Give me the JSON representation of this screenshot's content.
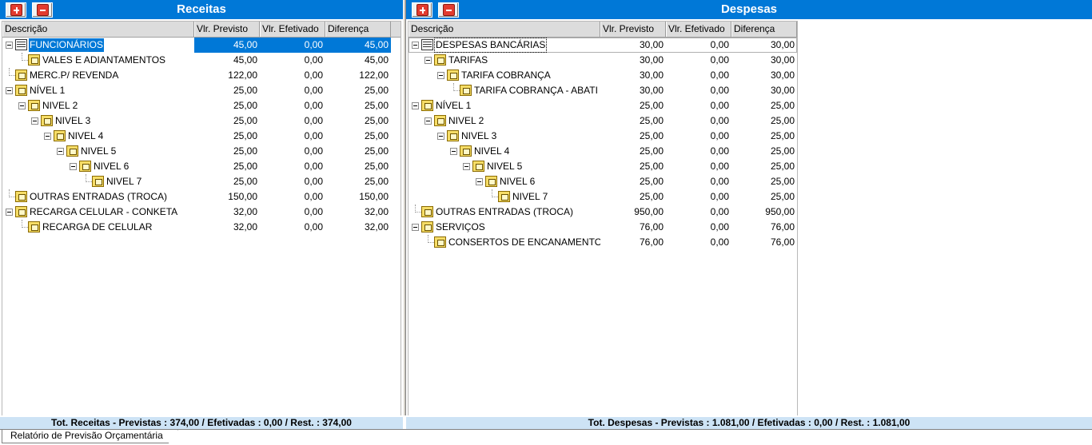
{
  "left": {
    "title": "Receitas",
    "columns": [
      "Descrição",
      "Vlr. Previsto",
      "Vlr. Efetivado",
      "Diferença"
    ],
    "rows": [
      {
        "level": 0,
        "icon": "table-icon",
        "toggle": true,
        "label": "FUNCIONÁRIOS",
        "prev": "45,00",
        "efet": "0,00",
        "dif": "45,00",
        "selected": true
      },
      {
        "level": 1,
        "icon": "folder-icon",
        "toggle": false,
        "label": "VALES E ADIANTAMENTOS",
        "prev": "45,00",
        "efet": "0,00",
        "dif": "45,00"
      },
      {
        "level": 0,
        "icon": "folder-icon",
        "toggle": false,
        "label": "MERC.P/ REVENDA",
        "prev": "122,00",
        "efet": "0,00",
        "dif": "122,00"
      },
      {
        "level": 0,
        "icon": "folder-icon",
        "toggle": true,
        "label": "NÍVEL 1",
        "prev": "25,00",
        "efet": "0,00",
        "dif": "25,00"
      },
      {
        "level": 1,
        "icon": "folder-icon",
        "toggle": true,
        "label": "NIVEL 2",
        "prev": "25,00",
        "efet": "0,00",
        "dif": "25,00"
      },
      {
        "level": 2,
        "icon": "folder-icon",
        "toggle": true,
        "label": "NIVEL 3",
        "prev": "25,00",
        "efet": "0,00",
        "dif": "25,00"
      },
      {
        "level": 3,
        "icon": "folder-icon",
        "toggle": true,
        "label": "NIVEL 4",
        "prev": "25,00",
        "efet": "0,00",
        "dif": "25,00"
      },
      {
        "level": 4,
        "icon": "folder-icon",
        "toggle": true,
        "label": "NIVEL 5",
        "prev": "25,00",
        "efet": "0,00",
        "dif": "25,00"
      },
      {
        "level": 5,
        "icon": "folder-icon",
        "toggle": true,
        "label": "NIVEL 6",
        "prev": "25,00",
        "efet": "0,00",
        "dif": "25,00"
      },
      {
        "level": 6,
        "icon": "folder-icon",
        "toggle": false,
        "label": "NIVEL 7",
        "prev": "25,00",
        "efet": "0,00",
        "dif": "25,00"
      },
      {
        "level": 0,
        "icon": "folder-icon",
        "toggle": false,
        "label": "OUTRAS ENTRADAS (TROCA)",
        "prev": "150,00",
        "efet": "0,00",
        "dif": "150,00"
      },
      {
        "level": 0,
        "icon": "folder-icon",
        "toggle": true,
        "label": "RECARGA CELULAR - CONKETA",
        "prev": "32,00",
        "efet": "0,00",
        "dif": "32,00"
      },
      {
        "level": 1,
        "icon": "folder-icon",
        "toggle": false,
        "label": "RECARGA DE CELULAR",
        "prev": "32,00",
        "efet": "0,00",
        "dif": "32,00"
      }
    ],
    "status": "Tot. Receitas - Previstas : 374,00 / Efetivadas : 0,00 / Rest. : 374,00"
  },
  "right": {
    "title": "Despesas",
    "columns": [
      "Descrição",
      "Vlr. Previsto",
      "Vlr. Efetivado",
      "Diferença"
    ],
    "rows": [
      {
        "level": 0,
        "icon": "table-icon",
        "toggle": true,
        "label": "DESPESAS BANCÁRIAS",
        "prev": "30,00",
        "efet": "0,00",
        "dif": "30,00",
        "focused": true
      },
      {
        "level": 1,
        "icon": "folder-icon",
        "toggle": true,
        "label": "TARIFAS",
        "prev": "30,00",
        "efet": "0,00",
        "dif": "30,00"
      },
      {
        "level": 2,
        "icon": "folder-icon",
        "toggle": true,
        "label": "TARIFA COBRANÇA",
        "prev": "30,00",
        "efet": "0,00",
        "dif": "30,00"
      },
      {
        "level": 3,
        "icon": "folder-icon",
        "toggle": false,
        "label": "TARIFA COBRANÇA - ABATI",
        "prev": "30,00",
        "efet": "0,00",
        "dif": "30,00"
      },
      {
        "level": 0,
        "icon": "folder-icon",
        "toggle": true,
        "label": "NÍVEL 1",
        "prev": "25,00",
        "efet": "0,00",
        "dif": "25,00"
      },
      {
        "level": 1,
        "icon": "folder-icon",
        "toggle": true,
        "label": "NIVEL 2",
        "prev": "25,00",
        "efet": "0,00",
        "dif": "25,00"
      },
      {
        "level": 2,
        "icon": "folder-icon",
        "toggle": true,
        "label": "NIVEL 3",
        "prev": "25,00",
        "efet": "0,00",
        "dif": "25,00"
      },
      {
        "level": 3,
        "icon": "folder-icon",
        "toggle": true,
        "label": "NIVEL 4",
        "prev": "25,00",
        "efet": "0,00",
        "dif": "25,00"
      },
      {
        "level": 4,
        "icon": "folder-icon",
        "toggle": true,
        "label": "NIVEL 5",
        "prev": "25,00",
        "efet": "0,00",
        "dif": "25,00"
      },
      {
        "level": 5,
        "icon": "folder-icon",
        "toggle": true,
        "label": "NIVEL 6",
        "prev": "25,00",
        "efet": "0,00",
        "dif": "25,00"
      },
      {
        "level": 6,
        "icon": "folder-icon",
        "toggle": false,
        "label": "NIVEL 7",
        "prev": "25,00",
        "efet": "0,00",
        "dif": "25,00"
      },
      {
        "level": 0,
        "icon": "folder-icon",
        "toggle": false,
        "label": "OUTRAS ENTRADAS (TROCA)",
        "prev": "950,00",
        "efet": "0,00",
        "dif": "950,00"
      },
      {
        "level": 0,
        "icon": "folder-icon",
        "toggle": true,
        "label": "SERVIÇOS",
        "prev": "76,00",
        "efet": "0,00",
        "dif": "76,00"
      },
      {
        "level": 1,
        "icon": "folder-icon",
        "toggle": false,
        "label": "CONSERTOS DE ENCANAMENTO",
        "prev": "76,00",
        "efet": "0,00",
        "dif": "76,00"
      }
    ],
    "status": "Tot. Despesas - Previstas : 1.081,00 / Efetivadas : 0,00 / Rest. : 1.081,00"
  },
  "tab_label": "Relatório de Previsão Orçamentária"
}
